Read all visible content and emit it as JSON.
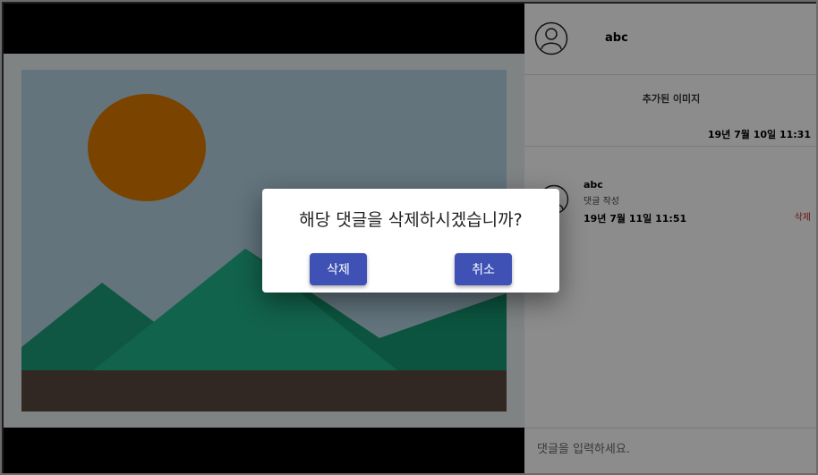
{
  "header": {
    "username": "abc",
    "avatar_icon": "user-circle-icon"
  },
  "post": {
    "caption": "추가된 이미지",
    "date": "19년 7월 10일 11:31"
  },
  "comment": {
    "author": "abc",
    "text": "댓글 작성",
    "date": "19년 7월 11일 11:51",
    "delete_label": "삭제",
    "avatar_icon": "user-circle-icon"
  },
  "comment_input": {
    "placeholder": "댓글을 입력하세요."
  },
  "media": {
    "image_icon": "landscape-placeholder-icon"
  },
  "dialog": {
    "message": "해당 댓글을 삭제하시겠습니까?",
    "confirm_label": "삭제",
    "cancel_label": "취소",
    "button_color": "#3f51b5"
  }
}
